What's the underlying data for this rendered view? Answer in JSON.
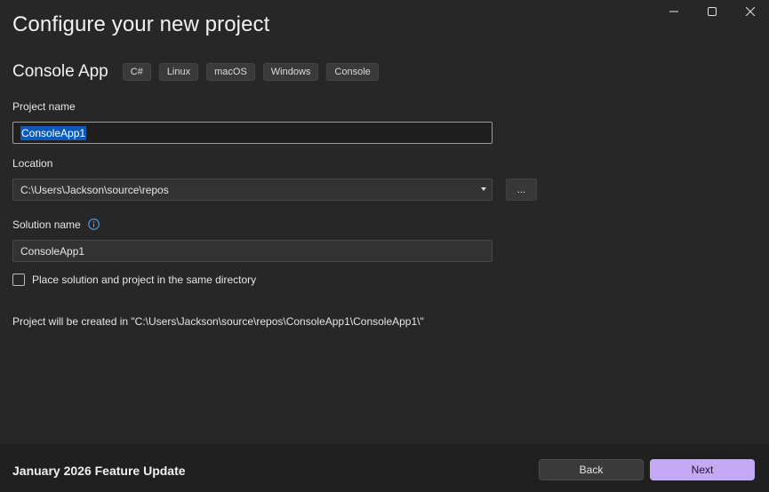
{
  "window": {
    "title": "Configure your new project",
    "controls": {
      "minimize_icon": "minimize-icon",
      "maximize_icon": "maximize-icon",
      "close_icon": "close-icon"
    }
  },
  "template": {
    "name": "Console App",
    "tags": [
      "C#",
      "Linux",
      "macOS",
      "Windows",
      "Console"
    ]
  },
  "form": {
    "project_name": {
      "label": "Project name",
      "value": "ConsoleApp1"
    },
    "location": {
      "label": "Location",
      "value": "C:\\Users\\Jackson\\source\\repos",
      "browse_label": "..."
    },
    "solution_name": {
      "label": "Solution name",
      "value": "ConsoleApp1"
    },
    "same_directory": {
      "label": "Place solution and project in the same directory",
      "checked": false
    },
    "path_info": "Project will be created in \"C:\\Users\\Jackson\\source\\repos\\ConsoleApp1\\ConsoleApp1\\\""
  },
  "footer": {
    "update_label": "January 2026 Feature Update",
    "back_label": "Back",
    "next_label": "Next"
  },
  "colors": {
    "background": "#272727",
    "footer_background": "#202020",
    "accent": "#c4a9f5",
    "selection": "#0c5ab8",
    "info_icon": "#4fa3e8"
  }
}
